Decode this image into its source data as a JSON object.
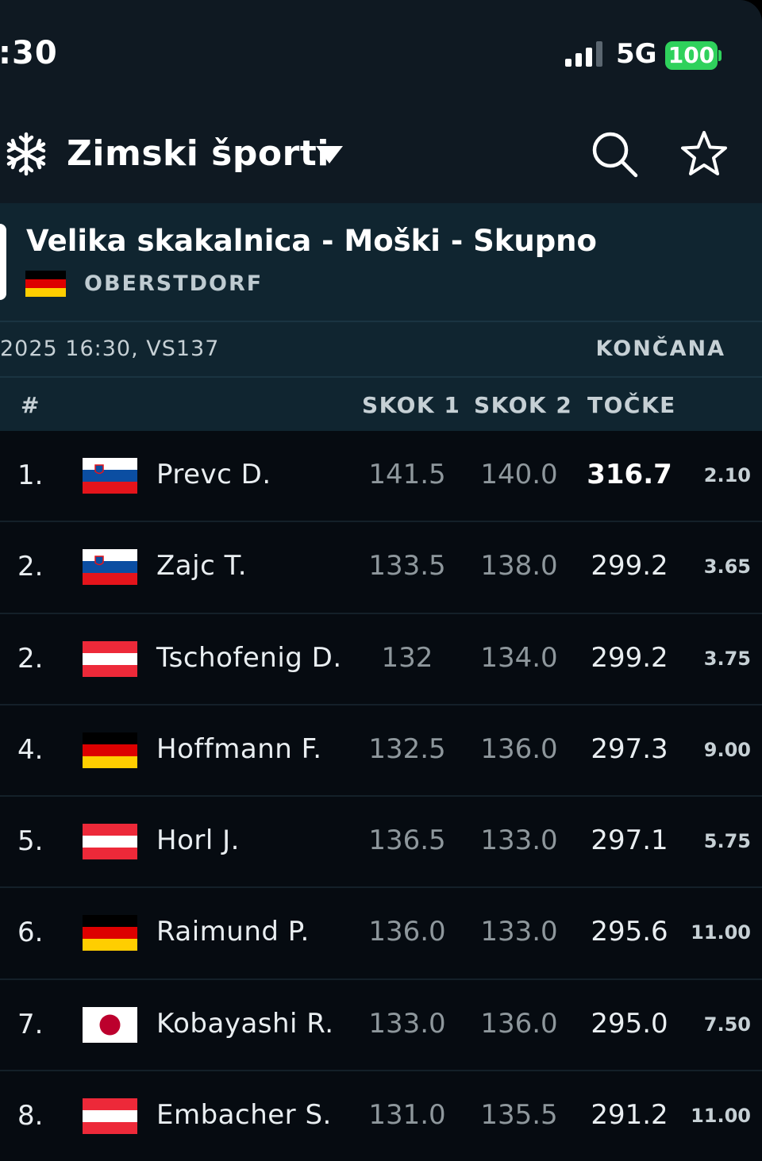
{
  "status_bar": {
    "time": ":30",
    "network": "5G",
    "battery": "100",
    "battery_color": "#2fd15c"
  },
  "app_bar": {
    "sport_icon": "snowflake-icon",
    "title": "Zimski športi",
    "dropdown_icon": "chevron-down-icon",
    "search_icon": "search-icon",
    "favorite_icon": "star-icon"
  },
  "event": {
    "title": "Velika skakalnica - Moški - Skupno",
    "country_flag": "flag-germany-icon",
    "venue": "OBERSTDORF",
    "datetime": "2025 16:30, VS137",
    "status": "KONČANA"
  },
  "table": {
    "headers": {
      "rank": "#",
      "jump1": "SKOK 1",
      "jump2": "SKOK 2",
      "points": "TOČKE"
    },
    "rows": [
      {
        "rank": "1.",
        "flag": "slovenia",
        "name": "Prevc D.",
        "jump1": "141.5",
        "jump2": "140.0",
        "points": "316.7",
        "extra": "2.10"
      },
      {
        "rank": "2.",
        "flag": "slovenia",
        "name": "Zajc T.",
        "jump1": "133.5",
        "jump2": "138.0",
        "points": "299.2",
        "extra": "3.65"
      },
      {
        "rank": "2.",
        "flag": "austria",
        "name": "Tschofenig D.",
        "jump1": "132",
        "jump2": "134.0",
        "points": "299.2",
        "extra": "3.75"
      },
      {
        "rank": "4.",
        "flag": "germany",
        "name": "Hoffmann F.",
        "jump1": "132.5",
        "jump2": "136.0",
        "points": "297.3",
        "extra": "9.00"
      },
      {
        "rank": "5.",
        "flag": "austria",
        "name": "Horl J.",
        "jump1": "136.5",
        "jump2": "133.0",
        "points": "297.1",
        "extra": "5.75"
      },
      {
        "rank": "6.",
        "flag": "germany",
        "name": "Raimund P.",
        "jump1": "136.0",
        "jump2": "133.0",
        "points": "295.6",
        "extra": "11.00"
      },
      {
        "rank": "7.",
        "flag": "japan",
        "name": "Kobayashi R.",
        "jump1": "133.0",
        "jump2": "136.0",
        "points": "295.0",
        "extra": "7.50"
      },
      {
        "rank": "8.",
        "flag": "austria",
        "name": "Embacher S.",
        "jump1": "131.0",
        "jump2": "135.5",
        "points": "291.2",
        "extra": "11.00"
      }
    ]
  }
}
